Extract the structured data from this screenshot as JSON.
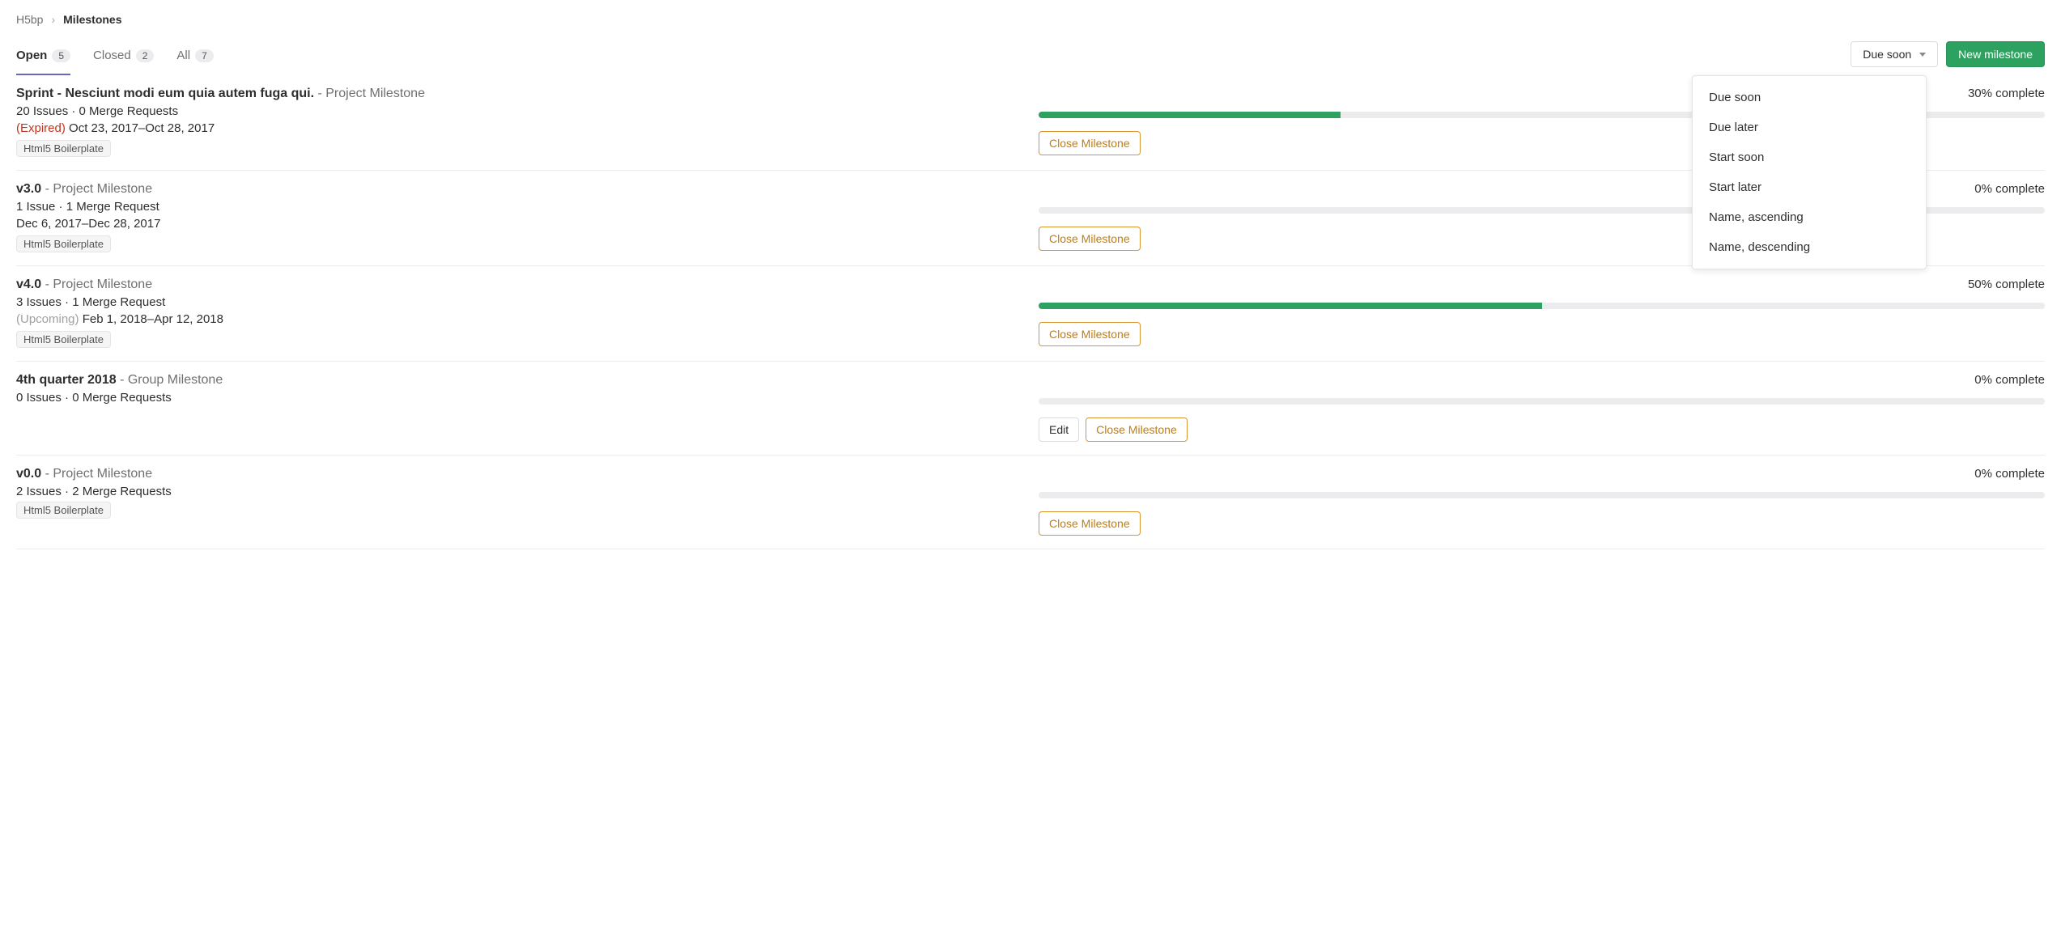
{
  "breadcrumb": {
    "root": "H5bp",
    "current": "Milestones"
  },
  "tabs": {
    "open": {
      "label": "Open",
      "count": "5"
    },
    "closed": {
      "label": "Closed",
      "count": "2"
    },
    "all": {
      "label": "All",
      "count": "7"
    }
  },
  "sort": {
    "selected": "Due soon",
    "options": [
      "Due soon",
      "Due later",
      "Start soon",
      "Start later",
      "Name, ascending",
      "Name, descending"
    ]
  },
  "buttons": {
    "new_milestone": "New milestone",
    "edit": "Edit",
    "close_milestone": "Close Milestone"
  },
  "labels": {
    "complete_suffix": "complete"
  },
  "milestones": [
    {
      "title": "Sprint - Nesciunt modi eum quia autem fuga qui.",
      "type": "- Project Milestone",
      "meta": "20 Issues · 0 Merge Requests",
      "status": "(Expired)",
      "status_class": "expired",
      "dates": "Oct 23, 2017–Oct 28, 2017",
      "project": "Html5 Boilerplate",
      "percent": 30,
      "percent_label": "30%",
      "has_edit": false
    },
    {
      "title": "v3.0",
      "type": "- Project Milestone",
      "meta": "1 Issue · 1 Merge Request",
      "status": "",
      "status_class": "",
      "dates": "Dec 6, 2017–Dec 28, 2017",
      "project": "Html5 Boilerplate",
      "percent": 0,
      "percent_label": "0%",
      "has_edit": false
    },
    {
      "title": "v4.0",
      "type": "- Project Milestone",
      "meta": "3 Issues · 1 Merge Request",
      "status": "(Upcoming)",
      "status_class": "upcoming",
      "dates": "Feb 1, 2018–Apr 12, 2018",
      "project": "Html5 Boilerplate",
      "percent": 50,
      "percent_label": "50%",
      "has_edit": false
    },
    {
      "title": "4th quarter 2018",
      "type": "- Group Milestone",
      "meta": "0 Issues · 0 Merge Requests",
      "status": "",
      "status_class": "",
      "dates": "",
      "project": "",
      "percent": 0,
      "percent_label": "0%",
      "has_edit": true
    },
    {
      "title": "v0.0",
      "type": "- Project Milestone",
      "meta": "2 Issues · 2 Merge Requests",
      "status": "",
      "status_class": "",
      "dates": "",
      "project": "Html5 Boilerplate",
      "percent": 0,
      "percent_label": "0%",
      "has_edit": false
    }
  ]
}
